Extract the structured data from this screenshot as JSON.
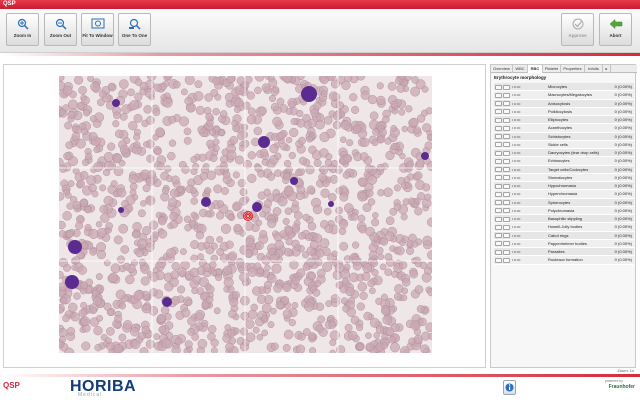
{
  "window": {
    "title": "QSP"
  },
  "toolbar": {
    "zoom_in": "Zoom In",
    "zoom_out": "Zoom Out",
    "fit_to_window": "Fit To Window",
    "one_to_one": "One To One",
    "approve": "Approve",
    "abort": "Abort"
  },
  "panel": {
    "tabs": [
      "Overview",
      "WBC",
      "RBC",
      "Platelet",
      "Properties",
      "Infoits"
    ],
    "active_tab": "RBC",
    "title": "Erythrocyte morphology",
    "rows": [
      {
        "dots": "• •• •••",
        "name": "Microcytes",
        "value": "0 (0.00%)"
      },
      {
        "dots": "• •• •••",
        "name": "Macrocytes/Megalocytes",
        "value": "0 (0.00%)"
      },
      {
        "dots": "• •• •••",
        "name": "Anisocytosis",
        "value": "0 (0.00%)"
      },
      {
        "dots": "• •• •••",
        "name": "Poikilocytosis",
        "value": "0 (0.00%)"
      },
      {
        "dots": "• •• •••",
        "name": "Elliptocytes",
        "value": "0 (0.00%)"
      },
      {
        "dots": "• •• •••",
        "name": "Acanthocytes",
        "value": "0 (0.00%)"
      },
      {
        "dots": "• •• •••",
        "name": "Schistocytes",
        "value": "0 (0.00%)"
      },
      {
        "dots": "• •• •••",
        "name": "Sickle cells",
        "value": "0 (0.00%)"
      },
      {
        "dots": "• •• •••",
        "name": "Dacryocytes (tear drop cells)",
        "value": "0 (0.00%)"
      },
      {
        "dots": "• •• •••",
        "name": "Echinocytes",
        "value": "0 (0.00%)"
      },
      {
        "dots": "• •• •••",
        "name": "Target cells/Codocytes",
        "value": "0 (0.00%)"
      },
      {
        "dots": "• •• •••",
        "name": "Stomatocytes",
        "value": "0 (0.00%)"
      },
      {
        "dots": "• •• •••",
        "name": "Hypochromasia",
        "value": "0 (0.00%)"
      },
      {
        "dots": "• •• •••",
        "name": "Hyperchromasia",
        "value": "0 (0.00%)"
      },
      {
        "dots": "• •• •••",
        "name": "Spherocytes",
        "value": "0 (0.00%)"
      },
      {
        "dots": "• •• •••",
        "name": "Polychromasia",
        "value": "0 (0.00%)"
      },
      {
        "dots": "• •• •••",
        "name": "Basophilic stippling",
        "value": "0 (0.00%)"
      },
      {
        "dots": "• •• •••",
        "name": "Howell-Jolly bodies",
        "value": "0 (0.00%)"
      },
      {
        "dots": "• •• •••",
        "name": "Cabot rings",
        "value": "0 (0.00%)"
      },
      {
        "dots": "• •• •••",
        "name": "Pappenheimer bodies",
        "value": "0 (0.00%)"
      },
      {
        "dots": "• •• •••",
        "name": "Parasites",
        "value": "0 (0.00%)"
      },
      {
        "dots": "• •• •••",
        "name": "Rouleaux formation",
        "value": "0 (0.00%)"
      }
    ]
  },
  "status": {
    "zoom": "Zoom: 1x"
  },
  "footer": {
    "app_logo": "QSP",
    "brand": "HORIBA",
    "brand_sub": "Medical",
    "partner_pre": "powered by",
    "partner": "Fraunhofer"
  },
  "colors": {
    "accent": "#d42b3c",
    "brand": "#123b7a",
    "cell": "#c9a8b3",
    "nucleus": "#5a2b91"
  }
}
